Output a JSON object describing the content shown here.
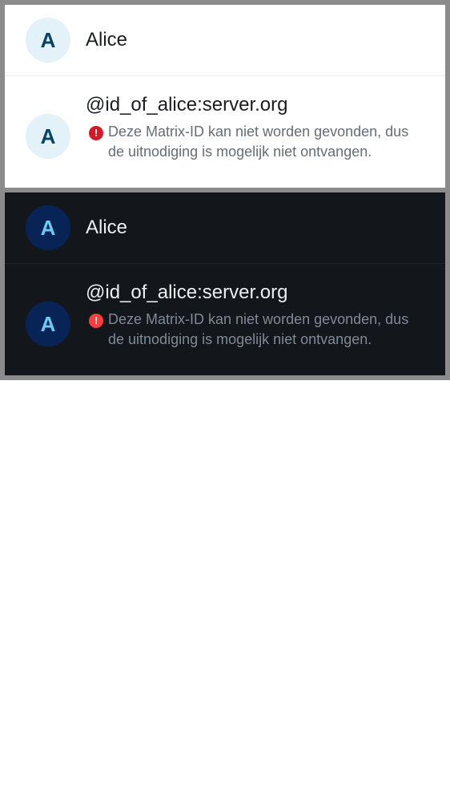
{
  "member": {
    "avatar_initial": "A",
    "display_name": "Alice",
    "matrix_id": "@id_of_alice:server.org",
    "warning_icon": "error-icon",
    "warning_text": "Deze Matrix-ID kan niet worden gevonden, dus de uitnodiging is mogelijk niet ontvangen."
  },
  "themes": {
    "light": {
      "background": "#ffffff",
      "text": "#1b1d22",
      "secondary": "#656d77",
      "error": "#d51928"
    },
    "dark": {
      "background": "#13171c",
      "text": "#ebeef2",
      "secondary": "#808994",
      "error": "#fd3e3c"
    }
  }
}
